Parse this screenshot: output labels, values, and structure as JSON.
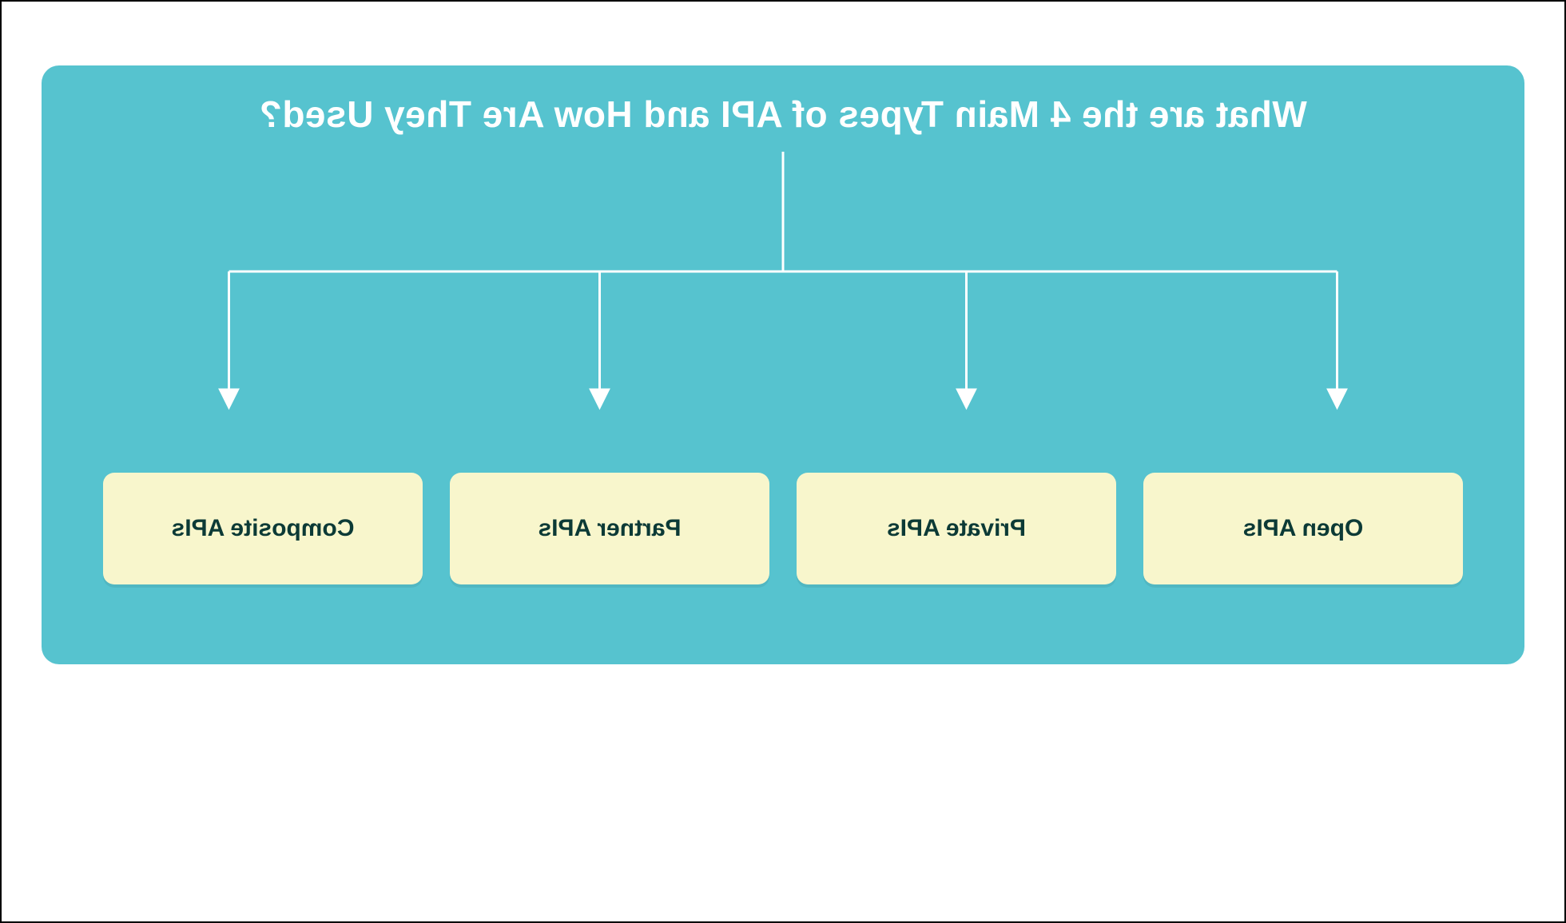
{
  "title": "What are the 4 Main Types of API and How Are They Used?",
  "boxes": [
    {
      "label": "Open APIs"
    },
    {
      "label": "Private APIs"
    },
    {
      "label": "Partner APIs"
    },
    {
      "label": "Composite APIs"
    }
  ],
  "colors": {
    "panel": "#56c3cf",
    "box_bg": "#f8f6cc",
    "box_text": "#0c3a36",
    "title_text": "#ffffff",
    "connector": "#ffffff"
  }
}
